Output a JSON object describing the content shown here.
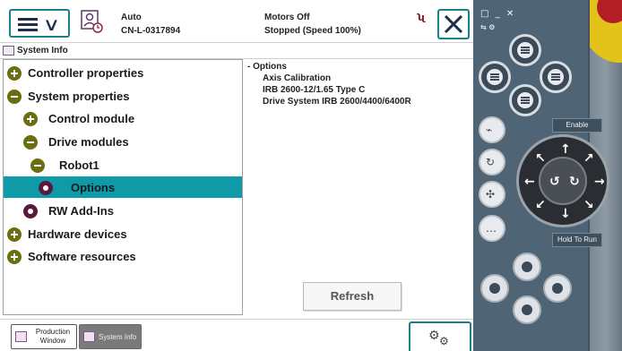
{
  "header": {
    "mode": "Auto",
    "system_name": "CN-L-0317894",
    "motor_state": "Motors Off",
    "run_state": "Stopped (Speed 100%)"
  },
  "window": {
    "title": "System Info"
  },
  "tree": {
    "items": [
      {
        "label": "Controller properties",
        "type": "plus",
        "level": 0
      },
      {
        "label": "System properties",
        "type": "minus",
        "level": 0
      },
      {
        "label": "Control module",
        "type": "plus",
        "level": 1
      },
      {
        "label": "Drive modules",
        "type": "minus",
        "level": 1
      },
      {
        "label": "Robot1",
        "type": "minus",
        "level": 2
      },
      {
        "label": "Options",
        "type": "dot",
        "level": 3,
        "selected": true
      },
      {
        "label": "RW Add-Ins",
        "type": "dot",
        "level": 1
      },
      {
        "label": "Hardware devices",
        "type": "plus",
        "level": 0
      },
      {
        "label": "Software resources",
        "type": "plus",
        "level": 0
      }
    ]
  },
  "detail": {
    "heading": "- Options",
    "lines": [
      "Axis Calibration",
      "IRB 2600-12/1.65 Type C",
      "Drive System IRB 2600/4400/6400R"
    ],
    "refresh_label": "Refresh"
  },
  "taskbar": {
    "production_label": "Production Window",
    "system_info_label": "System Info"
  },
  "pendant": {
    "enable_label": "Enable",
    "hold_label": "Hold To Run"
  },
  "colors": {
    "accent": "#18808a",
    "selection": "#0f9aa8",
    "node_olive": "#6b6e0e",
    "node_purple": "#5a1a3e",
    "pendant_body": "#4f6475"
  }
}
